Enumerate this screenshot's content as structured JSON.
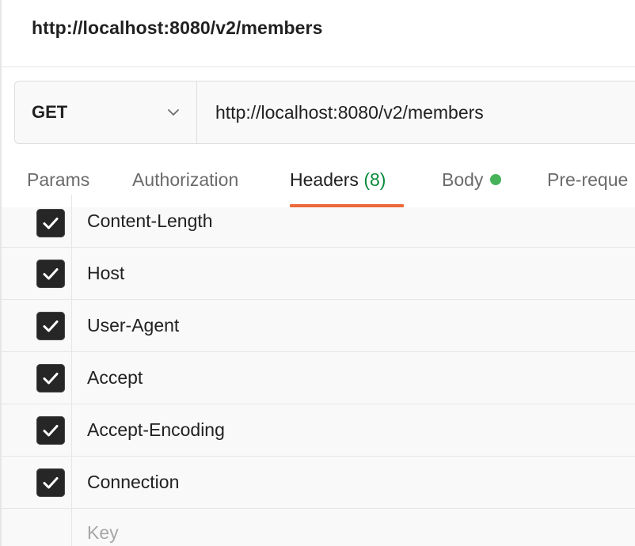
{
  "title": "http://localhost:8080/v2/members",
  "request": {
    "method": "GET",
    "url": "http://localhost:8080/v2/members"
  },
  "tabs": [
    {
      "label": "Params"
    },
    {
      "label": "Authorization"
    },
    {
      "label": "Headers",
      "count": "(8)"
    },
    {
      "label": "Body"
    },
    {
      "label": "Pre-reque"
    }
  ],
  "headers": {
    "rows": [
      {
        "key": "Content-Length",
        "checked": true
      },
      {
        "key": "Host",
        "checked": true
      },
      {
        "key": "User-Agent",
        "checked": true
      },
      {
        "key": "Accept",
        "checked": true
      },
      {
        "key": "Accept-Encoding",
        "checked": true
      },
      {
        "key": "Connection",
        "checked": true
      }
    ],
    "new_key_placeholder": "Key"
  },
  "colors": {
    "active_tab_underline": "#ec6a3a",
    "body_indicator": "#46b35b",
    "count_text": "#0a8a3a",
    "checkbox_fill": "#262626"
  }
}
